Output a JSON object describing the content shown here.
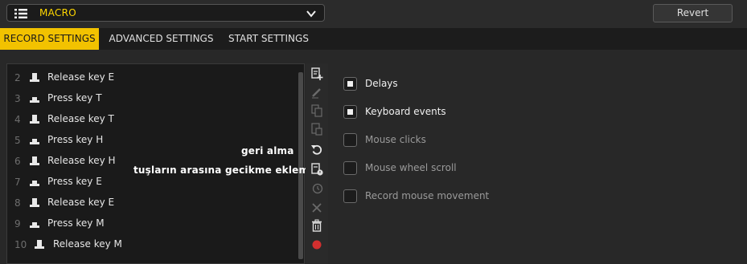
{
  "header": {
    "profile_select": {
      "value": "MACRO"
    },
    "revert_label": "Revert"
  },
  "tabs": [
    {
      "label": "RECORD SETTINGS",
      "active": true
    },
    {
      "label": "ADVANCED SETTINGS",
      "active": false
    },
    {
      "label": "START SETTINGS",
      "active": false
    }
  ],
  "macro_list": [
    {
      "num": "2",
      "label": "Release key E",
      "icon": "key-release-icon"
    },
    {
      "num": "3",
      "label": "Press key T",
      "icon": "key-press-icon"
    },
    {
      "num": "4",
      "label": "Release key T",
      "icon": "key-release-icon"
    },
    {
      "num": "5",
      "label": "Press key H",
      "icon": "key-press-icon"
    },
    {
      "num": "6",
      "label": "Release key H",
      "icon": "key-release-icon"
    },
    {
      "num": "7",
      "label": "Press key E",
      "icon": "key-press-icon"
    },
    {
      "num": "8",
      "label": "Release key E",
      "icon": "key-release-icon"
    },
    {
      "num": "9",
      "label": "Press key M",
      "icon": "key-press-icon"
    },
    {
      "num": "10",
      "label": "Release key M",
      "icon": "key-release-icon"
    }
  ],
  "annotations": {
    "undo_note": "geri alma",
    "delay_note": "tuşların arasına gecikme ekleme"
  },
  "toolbar_icons": [
    "add-action-icon",
    "edit-icon",
    "copy-icon",
    "paste-icon",
    "undo-icon",
    "insert-delay-icon",
    "history-icon",
    "close-icon",
    "trash-icon",
    "record-icon"
  ],
  "record_options": [
    {
      "label": "Delays",
      "checked": true
    },
    {
      "label": "Keyboard events",
      "checked": true
    },
    {
      "label": "Mouse clicks",
      "checked": false
    },
    {
      "label": "Mouse wheel scroll",
      "checked": false
    },
    {
      "label": "Record mouse movement",
      "checked": false
    }
  ],
  "colors": {
    "accent": "#f2c200",
    "profile_text": "#ffd700",
    "record_red": "#d32f2f"
  }
}
